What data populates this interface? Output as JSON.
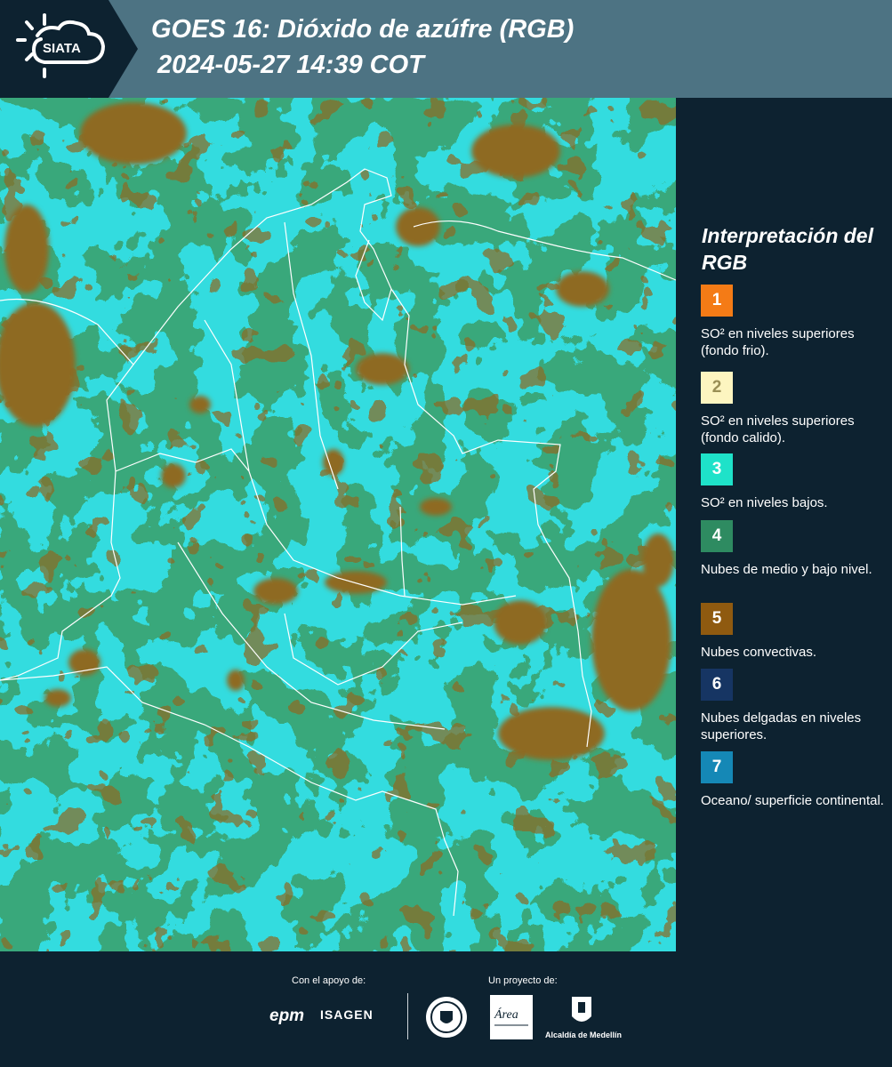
{
  "header": {
    "logo_text": "SIATA",
    "title_line1": "GOES 16: Dióxido de azúfre (RGB)",
    "title_line2": "2024-05-27 14:39 COT"
  },
  "legend": {
    "title": "Interpretación del RGB",
    "items": [
      {
        "number": "1",
        "color": "#f47b16",
        "text": "SO² en niveles superiores (fondo frio)."
      },
      {
        "number": "2",
        "color": "#fdf5c0",
        "text": "SO² en niveles superiores (fondo calido)."
      },
      {
        "number": "3",
        "color": "#1ee2c9",
        "text": "SO² en niveles bajos."
      },
      {
        "number": "4",
        "color": "#2e8b61",
        "text": "Nubes de medio y bajo nivel."
      },
      {
        "number": "5",
        "color": "#8f5a10",
        "text": "Nubes convectivas."
      },
      {
        "number": "6",
        "color": "#163563",
        "text": "Nubes delgadas en niveles superiores."
      },
      {
        "number": "7",
        "color": "#1588b6",
        "text": "Oceano/ superficie continental."
      }
    ]
  },
  "footer": {
    "support_label": "Con el apoyo de:",
    "project_label": "Un proyecto de:",
    "epm_logo_text": "epm",
    "isagen_logo_text": "ISAGEN",
    "area_logo_text": "Área",
    "alcaldia_label": "Alcaldía de Medellín"
  },
  "map_colors": {
    "background": "#1ad9dc",
    "low_cloud": "#3a9f6a",
    "convective": "#8e6a22",
    "borders": "#ffffff"
  }
}
